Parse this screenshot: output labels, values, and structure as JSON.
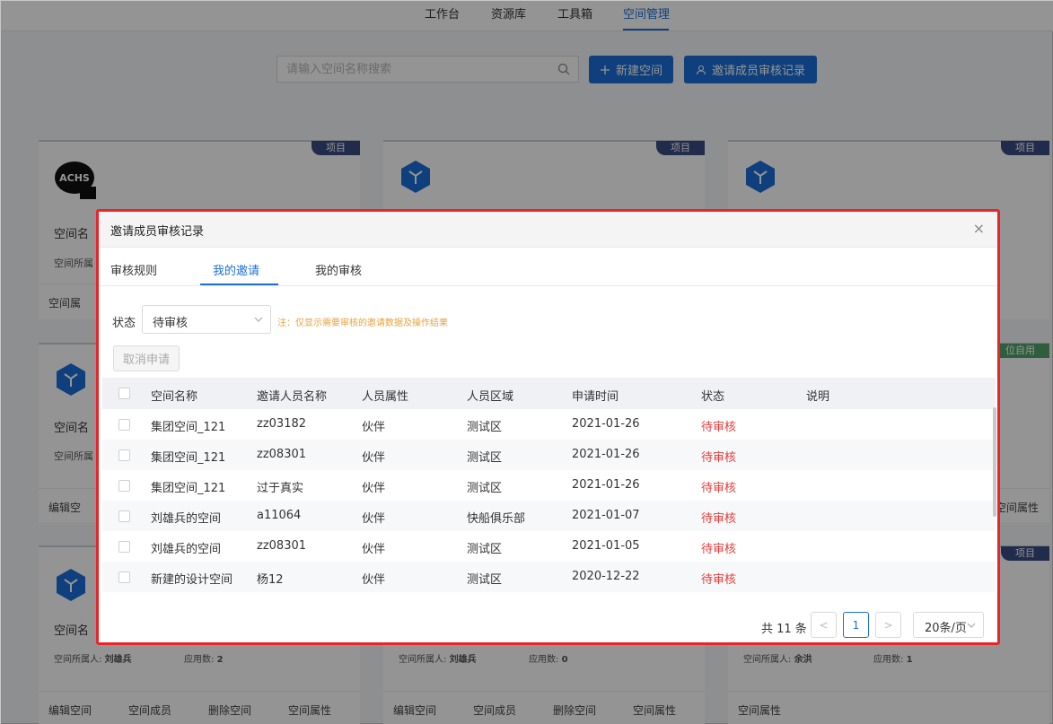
{
  "topnav": {
    "items": [
      {
        "label": "工作台"
      },
      {
        "label": "资源库"
      },
      {
        "label": "工具箱"
      },
      {
        "label": "空间管理"
      }
    ]
  },
  "search": {
    "placeholder": "请输入空间名称搜索"
  },
  "toolbar": {
    "new_space_label": "新建空间",
    "invite_records_label": "邀请成员审核记录"
  },
  "cards": {
    "tag_project": "项目",
    "tag_unit": "位自用",
    "logo_text": "ACHS",
    "name_label": "空间名",
    "owner_label": "空间所属",
    "owner_full_label": "空间所属人:",
    "apps_label": "应用数:",
    "card7_owner": "刘雄兵",
    "card7_apps": "2",
    "card8_owner": "刘雄兵",
    "card8_apps": "0",
    "card9_owner": "余洪",
    "card9_apps": "1",
    "footer_attr_short": "空间属",
    "footer_edit_short": "编辑空",
    "footer_attr_tail": "空间属性",
    "footer_edit": "编辑空间",
    "footer_members": "空间成员",
    "footer_delete": "删除空间",
    "footer_attr": "空间属性"
  },
  "dialog": {
    "title": "邀请成员审核记录",
    "close_glyph": "×",
    "tabs": [
      {
        "label": "审核规则"
      },
      {
        "label": "我的邀请"
      },
      {
        "label": "我的审核"
      }
    ],
    "filter": {
      "label": "状态",
      "selected": "待审核",
      "note": "注：仅显示需要审核的邀请数据及操作结果"
    },
    "cancel_label": "取消申请",
    "table": {
      "headers": [
        "空间名称",
        "邀请人员名称",
        "人员属性",
        "人员区域",
        "申请时间",
        "状态",
        "说明"
      ],
      "rows": [
        [
          "集团空间_121",
          "zz03182",
          "伙伴",
          "测试区",
          "2021-01-26",
          "待审核",
          ""
        ],
        [
          "集团空间_121",
          "zz08301",
          "伙伴",
          "测试区",
          "2021-01-26",
          "待审核",
          ""
        ],
        [
          "集团空间_121",
          "过于真实",
          "伙伴",
          "测试区",
          "2021-01-26",
          "待审核",
          ""
        ],
        [
          "刘雄兵的空间",
          "a11064",
          "伙伴",
          "快船俱乐部",
          "2021-01-07",
          "待审核",
          ""
        ],
        [
          "刘雄兵的空间",
          "zz08301",
          "伙伴",
          "测试区",
          "2021-01-05",
          "待审核",
          ""
        ],
        [
          "新建的设计空间",
          "杨12",
          "伙伴",
          "测试区",
          "2020-12-22",
          "待审核",
          ""
        ]
      ]
    },
    "pagination": {
      "total": "共 11 条",
      "prev": "<",
      "page": "1",
      "next": ">",
      "size": "20条/页"
    }
  },
  "colors": {
    "primary": "#1a6fd8",
    "pending_status": "#e23b3b",
    "note": "#e6a23c",
    "highlight_border": "#e8262a",
    "tag": "#3a4a82"
  }
}
